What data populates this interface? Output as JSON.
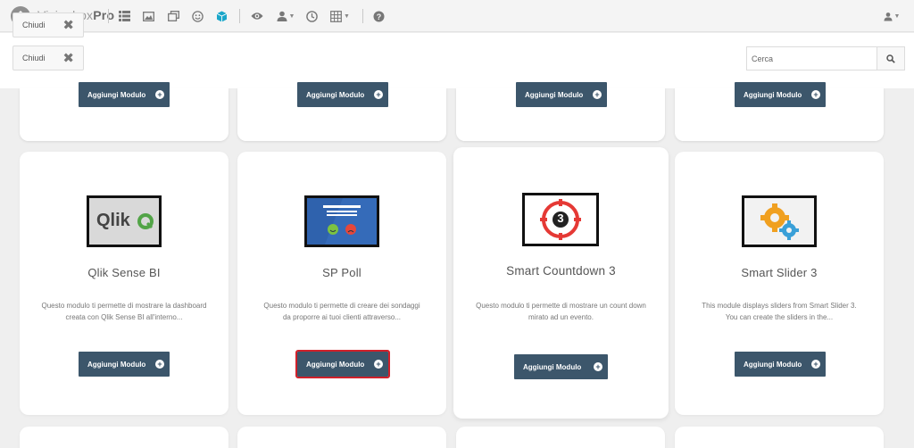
{
  "app": {
    "brand_light": "Visionbox",
    "brand_bold": "Pro"
  },
  "toolbar": {
    "icons": [
      "list-icon",
      "image-icon",
      "copy-icon",
      "smiley-icon",
      "cube-icon",
      "eye-icon",
      "user-icon",
      "clock-icon",
      "grid-icon",
      "help-icon"
    ],
    "accent_color": "#1aa6c9"
  },
  "filter": {
    "close_label": "Chiudi",
    "search_placeholder": "Cerca"
  },
  "add_label": "Aggiungi Modulo",
  "modules": [
    {
      "title": "Qlik Sense BI",
      "description": "Questo modulo ti permette di mostrare la dashboard creata con Qlik Sense BI all'interno...",
      "thumb_text": "Qlik"
    },
    {
      "title": "SP Poll",
      "description": "Questo modulo ti permette di creare dei sondaggi da proporre ai tuoi clienti attraverso..."
    },
    {
      "title": "Smart Countdown 3",
      "description": "Questo modulo ti permette di mostrare un count down mirato ad un evento.",
      "thumb_text": "3"
    },
    {
      "title": "Smart Slider 3",
      "description": "This module displays sliders from Smart Slider 3. You can create the sliders in the..."
    }
  ],
  "colors": {
    "button": "#3c566b",
    "highlight": "#d0202a"
  }
}
